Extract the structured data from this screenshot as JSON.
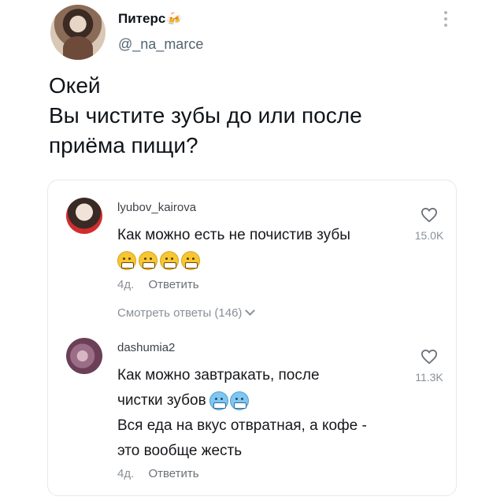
{
  "post": {
    "author_name": "Питерс",
    "author_badge_icon": "beer-mugs-icon",
    "author_handle": "@_na_marce",
    "text_lines": [
      "Окей",
      "Вы чистите зубы до или после",
      "приёма пищи?"
    ]
  },
  "comments": [
    {
      "username": "lyubov_kairova",
      "text_lines": [
        "Как можно есть не почистив зубы"
      ],
      "emojis": [
        "grimacing-face-icon",
        "grimacing-face-icon",
        "grimacing-face-icon",
        "grimacing-face-icon"
      ],
      "likes": "15.0K",
      "time": "4д.",
      "reply_label": "Ответить",
      "view_replies": "Смотреть ответы (146)"
    },
    {
      "username": "dashumia2",
      "text_lines": [
        "Как можно завтракать, после",
        "чистки зубов",
        "Вся еда на вкус отвратная, а кофе -",
        "это вообще жесть"
      ],
      "emojis": [
        "cold-face-icon",
        "cold-face-icon"
      ],
      "likes": "11.3K",
      "time": "4д.",
      "reply_label": "Ответить"
    }
  ],
  "colors": {
    "text": "#0f1419",
    "muted": "#8a9097",
    "border": "#e6e8ea"
  }
}
